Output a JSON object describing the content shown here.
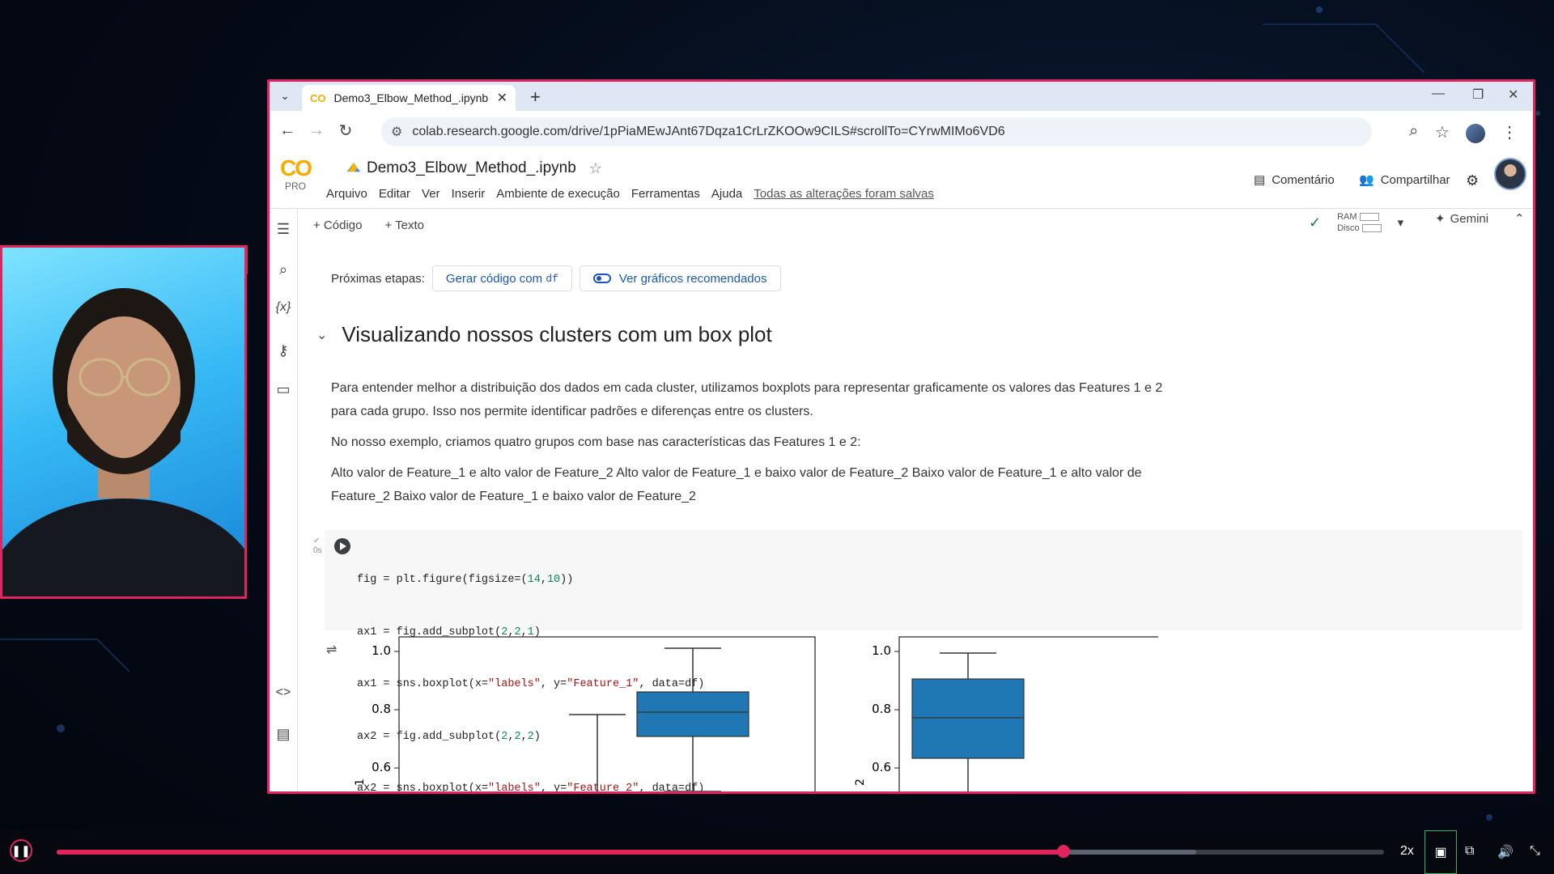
{
  "browser": {
    "tab_title": "Demo3_Elbow_Method_.ipynb",
    "url": "colab.research.google.com/drive/1pPiaMEwJAnt67Dqza1CrLrZKOOw9CILS#scrollTo=CYrwMIMo6VD6"
  },
  "colab": {
    "logo": "CO",
    "tier": "PRO",
    "notebook_title": "Demo3_Elbow_Method_.ipynb",
    "menu": [
      "Arquivo",
      "Editar",
      "Ver",
      "Inserir",
      "Ambiente de execução",
      "Ferramentas",
      "Ajuda"
    ],
    "save_status": "Todas as alterações foram salvas",
    "comment_label": "Comentário",
    "share_label": "Compartilhar"
  },
  "toolbar": {
    "add_code": "+ Código",
    "add_text": "+ Texto",
    "ram_label": "RAM",
    "disk_label": "Disco",
    "gemini_label": "Gemini"
  },
  "next_steps": {
    "label": "Próximas etapas:",
    "generate_code": "Gerar código com",
    "generate_code_var": "df",
    "charts": "Ver gráficos recomendados"
  },
  "section": {
    "title": "Visualizando nossos clusters com um box plot",
    "para1": "Para entender melhor a distribuição dos dados em cada cluster, utilizamos boxplots para representar graficamente os valores das Features 1 e 2 para cada grupo. Isso nos permite identificar padrões e diferenças entre os clusters.",
    "para2": "No nosso exemplo, criamos quatro grupos com base nas características das Features 1 e 2:",
    "para3": "Alto valor de Feature_1 e alto valor de Feature_2 Alto valor de Feature_1 e baixo valor de Feature_2 Baixo valor de Feature_1 e alto valor de Feature_2 Baixo valor de Feature_1 e baixo valor de Feature_2"
  },
  "cell": {
    "status": "0s",
    "code_lines": [
      "fig = plt.figure(figsize=(14,10))",
      "ax1 = fig.add_subplot(2,2,1)",
      "ax1 = sns.boxplot(x=\"labels\", y=\"Feature_1\", data=df)",
      "ax2 = fig.add_subplot(2,2,2)",
      "ax2 = sns.boxplot(x=\"labels\", y=\"Feature_2\", data=df)"
    ]
  },
  "plot_output": {
    "ytick_labels": [
      "1.0",
      "0.8",
      "0.6"
    ],
    "ylabel_1_partial": "1",
    "ylabel_2_partial": "2",
    "box_color": "#1f77b4"
  },
  "player": {
    "speed": "2x",
    "progress": 0.759,
    "buffered": 0.859
  },
  "colors": {
    "accent": "#e0245e",
    "colab_orange": "#f9ab00",
    "link_blue": "#1a57b5"
  }
}
